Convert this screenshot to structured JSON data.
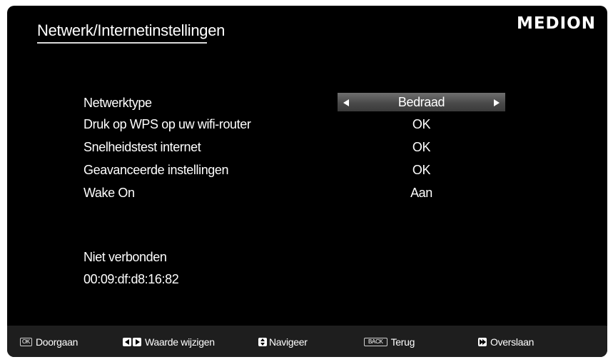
{
  "header": {
    "title": "Netwerk/Internetinstellingen",
    "logo": "MEDION"
  },
  "settings": [
    {
      "label": "Netwerktype",
      "value": "Bedraad"
    },
    {
      "label": "Druk op WPS op uw wifi-router",
      "value": "OK"
    },
    {
      "label": "Snelheidstest internet",
      "value": "OK"
    },
    {
      "label": "Geavanceerde instellingen",
      "value": "OK"
    },
    {
      "label": "Wake On",
      "value": "Aan"
    }
  ],
  "status": {
    "connection": "Niet verbonden",
    "mac_address": "00:09:df:d8:16:82"
  },
  "footer": {
    "ok_key": "OK",
    "ok_label": "Doorgaan",
    "change_label": "Waarde wijzigen",
    "navigate_label": "Navigeer",
    "back_key": "BACK",
    "back_label": "Terug",
    "skip_label": "Overslaan"
  },
  "colors": {
    "background": "#000000",
    "text": "#ffffff",
    "selector": "#5a5a5a",
    "bottom_bar": "#1e1e1e"
  }
}
